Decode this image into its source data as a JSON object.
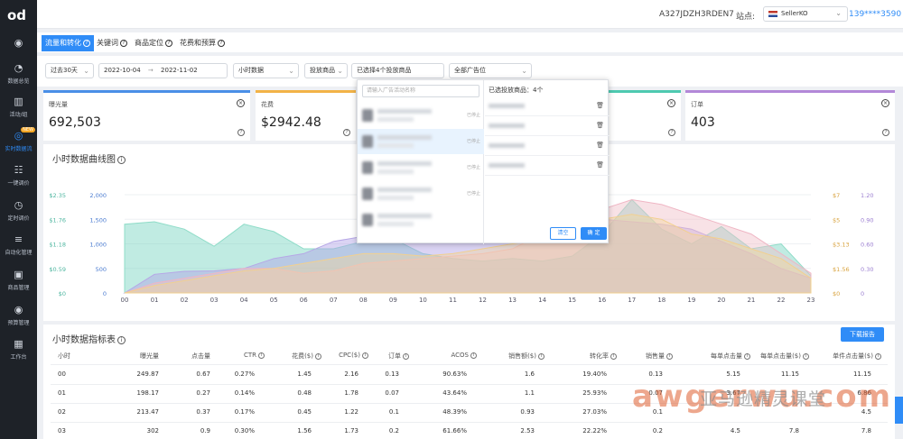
{
  "sidebar": {
    "logo": "od",
    "items": [
      {
        "label": "",
        "icon": "circle-dot-icon"
      },
      {
        "label": "数据总览",
        "icon": "pie-chart-icon"
      },
      {
        "label": "活动/组",
        "icon": "bar-chart-icon"
      },
      {
        "label": "实时数据流",
        "icon": "realtime-icon",
        "badge": "NEW"
      },
      {
        "label": "一键调价",
        "icon": "sliders-icon"
      },
      {
        "label": "定时调价",
        "icon": "clock-icon"
      },
      {
        "label": "自动化管理",
        "icon": "settings-sliders-icon"
      },
      {
        "label": "商品管理",
        "icon": "box-icon"
      },
      {
        "label": "预算管理",
        "icon": "budget-icon"
      },
      {
        "label": "工作台",
        "icon": "grid-icon"
      }
    ]
  },
  "topbar": {
    "seller_id": "A327JDZH3RDEN7",
    "site_label": "站点:",
    "site_value": "SellerKO",
    "phone": "139****3590"
  },
  "tabs": [
    {
      "label": "流量和转化"
    },
    {
      "label": "关键词"
    },
    {
      "label": "商品定位"
    },
    {
      "label": "花费和预算"
    }
  ],
  "filters": {
    "period": "过去30天",
    "date_start": "2022-10-04",
    "arrow": "→",
    "date_end": "2022-11-02",
    "granularity": "小时数据",
    "target": "投放商品",
    "selected": "已选择4个投放商品",
    "placement": "全部广告位"
  },
  "cards": [
    {
      "title": "曝光量",
      "value": "692,503"
    },
    {
      "title": "花费",
      "value": "$2942.48"
    },
    {
      "title": "",
      "value": ""
    },
    {
      "title": "订单",
      "value": "403"
    }
  ],
  "chart": {
    "title": "小时数据曲线图"
  },
  "chart_data": {
    "type": "area",
    "x": [
      "00",
      "01",
      "02",
      "03",
      "04",
      "05",
      "06",
      "07",
      "08",
      "09",
      "10",
      "11",
      "12",
      "13",
      "14",
      "15",
      "16",
      "17",
      "18",
      "19",
      "20",
      "21",
      "22",
      "23"
    ],
    "left_axis_a": [
      "$0",
      "$0.59",
      "$1.18",
      "$1.76",
      "$2.35"
    ],
    "left_axis_b": [
      "0",
      "500",
      "1,000",
      "1,500",
      "2,000"
    ],
    "right_axis_a": [
      "$0",
      "$1.56",
      "$3.13",
      "$5",
      "$7"
    ],
    "right_axis_b": [
      "0",
      "0.30",
      "0.60",
      "0.90",
      "1.20"
    ],
    "series": [
      {
        "values": [
          1400,
          1450,
          1300,
          950,
          1400,
          1250,
          900,
          900,
          1050,
          1100,
          800,
          700,
          650,
          700,
          650,
          750,
          1200,
          1900,
          1300,
          1000,
          1350,
          900,
          1000,
          350
        ]
      },
      {
        "values": [
          0,
          380,
          440,
          450,
          500,
          700,
          800,
          1050,
          1150,
          1200,
          1300,
          1400,
          1450,
          1500,
          1550,
          1550,
          1500,
          1450,
          1400,
          1300,
          1050,
          800,
          500,
          300
        ]
      },
      {
        "values": [
          0,
          200,
          300,
          400,
          500,
          500,
          400,
          450,
          600,
          650,
          700,
          750,
          800,
          900,
          1200,
          1400,
          1700,
          1900,
          1800,
          1600,
          1400,
          1200,
          800,
          400
        ]
      },
      {
        "values": [
          0,
          150,
          250,
          350,
          450,
          500,
          600,
          700,
          800,
          800,
          750,
          800,
          900,
          1000,
          1100,
          1300,
          1500,
          1600,
          1500,
          1200,
          1100,
          900,
          700,
          300
        ]
      }
    ]
  },
  "popup": {
    "search_placeholder": "请输入广告活动名称",
    "status_text": "已停止",
    "selected_header": "已选投放商品：4个",
    "clear_label": "清空",
    "confirm_label": "确 定"
  },
  "table": {
    "title": "小时数据指标表",
    "download_label": "下载报告",
    "headers": [
      "小时",
      "曝光量",
      "点击量",
      "CTR",
      "花费($)",
      "CPC($)",
      "订单",
      "ACOS",
      "销售额($)",
      "转化率",
      "销售量",
      "每单点击量",
      "每单点击量($)",
      "单件点击量($)"
    ],
    "rows": [
      [
        "00",
        "249.87",
        "0.67",
        "0.27%",
        "1.45",
        "2.16",
        "0.13",
        "90.63%",
        "1.6",
        "19.40%",
        "0.13",
        "5.15",
        "11.15",
        "11.15"
      ],
      [
        "01",
        "198.17",
        "0.27",
        "0.14%",
        "0.48",
        "1.78",
        "0.07",
        "43.64%",
        "1.1",
        "25.93%",
        "0.07",
        "3.67",
        "",
        "6.86"
      ],
      [
        "02",
        "213.47",
        "0.37",
        "0.17%",
        "0.45",
        "1.22",
        "0.1",
        "48.39%",
        "0.93",
        "27.03%",
        "0.1",
        "",
        "",
        "4.5"
      ],
      [
        "03",
        "302",
        "0.9",
        "0.30%",
        "1.56",
        "1.73",
        "0.2",
        "61.66%",
        "2.53",
        "22.22%",
        "0.2",
        "4.5",
        "7.8",
        "7.8"
      ]
    ]
  },
  "watermark": {
    "latin": "awgerwu.com",
    "cn": "亚马逊精灵课堂"
  }
}
